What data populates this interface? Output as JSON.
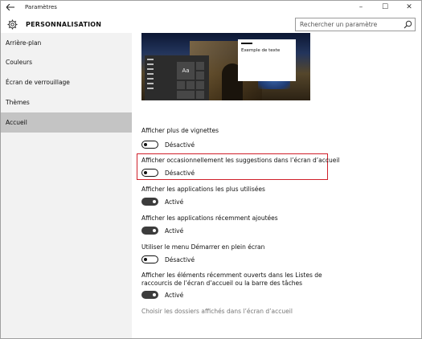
{
  "window": {
    "title": "Paramètres",
    "controls": {
      "minimize": "–",
      "maximize": "☐",
      "close": "✕"
    }
  },
  "header": {
    "title": "PERSONNALISATION",
    "search_placeholder": "Rechercher un paramètre"
  },
  "sidebar": {
    "items": [
      {
        "label": "Arrière-plan"
      },
      {
        "label": "Couleurs"
      },
      {
        "label": "Écran de verrouillage"
      },
      {
        "label": "Thèmes"
      },
      {
        "label": "Accueil",
        "selected": true
      }
    ]
  },
  "preview": {
    "tile_label": "Aa",
    "sample_text": "Exemple de texte"
  },
  "settings": [
    {
      "label": "Afficher plus de vignettes",
      "state": "Désactivé",
      "on": false
    },
    {
      "label": "Afficher occasionnellement les suggestions dans l’écran d’accueil",
      "state": "Désactivé",
      "on": false,
      "highlighted": true
    },
    {
      "label": "Afficher les applications les plus utilisées",
      "state": "Activé",
      "on": true
    },
    {
      "label": "Afficher les applications récemment ajoutées",
      "state": "Activé",
      "on": true
    },
    {
      "label": "Utiliser le menu Démarrer en plein écran",
      "state": "Désactivé",
      "on": false
    },
    {
      "label_line1": "Afficher les éléments récemment ouverts dans les Listes de",
      "label_line2": "raccourcis de l’écran d’accueil ou la barre des tâches",
      "state": "Activé",
      "on": true
    }
  ],
  "link": "Choisir les dossiers affichés dans l’écran d’accueil",
  "colors": {
    "accent_highlight": "#d0202a",
    "sidebar_bg": "#f2f2f2",
    "selected_bg": "#c4c4c4"
  }
}
